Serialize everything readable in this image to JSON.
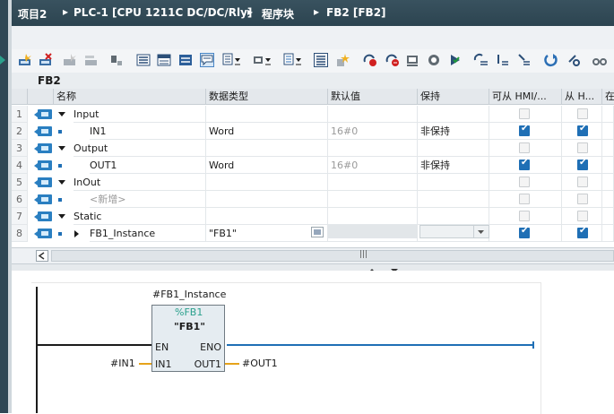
{
  "breadcrumb": {
    "items": [
      "项目2",
      "PLC-1 [CPU 1211C DC/DC/Rly]",
      "程序块",
      "FB2 [FB2]"
    ],
    "separator": "▸"
  },
  "block": {
    "name": "FB2"
  },
  "table": {
    "headers": [
      "名称",
      "数据类型",
      "默认值",
      "保持",
      "可从 HMI/...",
      "从 H...",
      "在"
    ],
    "rows": [
      {
        "num": "1",
        "name": "Input",
        "type": "",
        "default": "",
        "retain": "",
        "hmi1": "disabled",
        "hmi2": "disabled",
        "kind": "section"
      },
      {
        "num": "2",
        "name": "IN1",
        "type": "Word",
        "default": "16#0",
        "retain": "非保持",
        "hmi1": "checked",
        "hmi2": "checked",
        "kind": "var"
      },
      {
        "num": "3",
        "name": "Output",
        "type": "",
        "default": "",
        "retain": "",
        "hmi1": "disabled",
        "hmi2": "disabled",
        "kind": "section"
      },
      {
        "num": "4",
        "name": "OUT1",
        "type": "Word",
        "default": "16#0",
        "retain": "非保持",
        "hmi1": "checked",
        "hmi2": "checked",
        "kind": "var"
      },
      {
        "num": "5",
        "name": "InOut",
        "type": "",
        "default": "",
        "retain": "",
        "hmi1": "disabled",
        "hmi2": "disabled",
        "kind": "section"
      },
      {
        "num": "6",
        "name": "<新增>",
        "type": "",
        "default": "",
        "retain": "",
        "hmi1": "disabled",
        "hmi2": "disabled",
        "kind": "add"
      },
      {
        "num": "7",
        "name": "Static",
        "type": "",
        "default": "",
        "retain": "",
        "hmi1": "disabled",
        "hmi2": "disabled",
        "kind": "section"
      },
      {
        "num": "8",
        "name": "FB1_Instance",
        "type": "\"FB1\"",
        "default": "",
        "retain": "",
        "hmi1": "checked",
        "hmi2": "checked",
        "kind": "instance"
      }
    ]
  },
  "ladder": {
    "instance_label": "#FB1_Instance",
    "block_address": "%FB1",
    "block_name": "\"FB1\"",
    "en": "EN",
    "eno": "ENO",
    "in_pin": "IN1",
    "out_pin": "OUT1",
    "in_operand": "#IN1",
    "out_operand": "#OUT1"
  },
  "scroll": {
    "grip": "|||"
  },
  "colors": {
    "titlebar": "#2c4450",
    "accent": "#1f6fb5",
    "block_fill": "#e5ecf1",
    "address": "#2aa08c",
    "wire_in": "#e6a21a"
  }
}
